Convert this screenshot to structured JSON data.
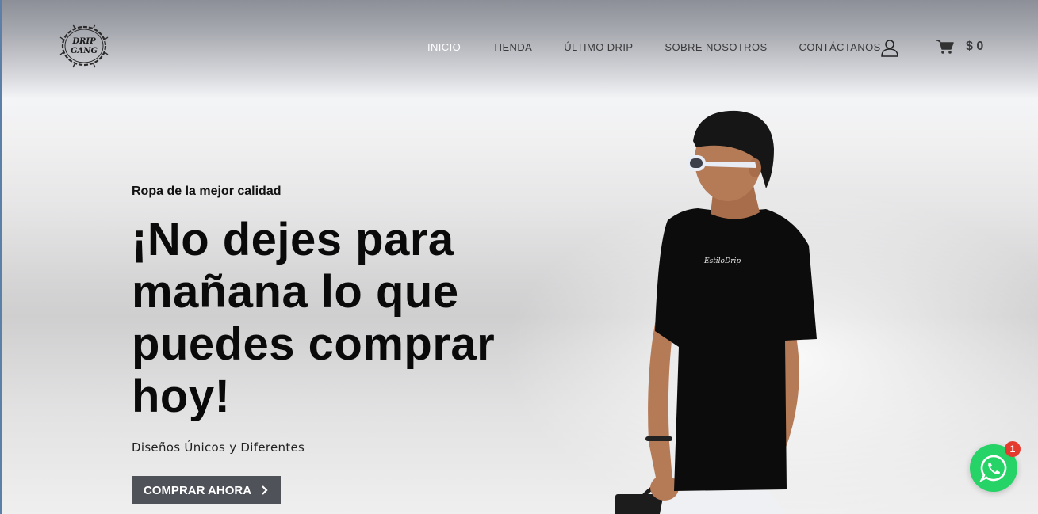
{
  "brand": {
    "logo_text_line1": "DRIP",
    "logo_text_line2": "GANG"
  },
  "nav": {
    "items": [
      {
        "label": "INICIO",
        "active": true
      },
      {
        "label": "TIENDA",
        "active": false
      },
      {
        "label": "ÚLTIMO DRIP",
        "active": false
      },
      {
        "label": "SOBRE NOSOTROS",
        "active": false
      },
      {
        "label": "CONTÁCTANOS",
        "active": false
      }
    ],
    "account_icon": "user-icon",
    "cart_icon": "cart-icon",
    "cart_total": "$ 0"
  },
  "hero": {
    "eyebrow": "Ropa de la mejor calidad",
    "headline": "¡No dejes para mañana lo que puedes comprar hoy!",
    "subtitle": "Diseños Únicos y Diferentes",
    "cta_label": "COMPRAR AHORA",
    "cta_icon": "chevron-right-icon",
    "shirt_print": "EstiloDrip"
  },
  "whatsapp": {
    "icon": "whatsapp-icon",
    "badge_count": "1"
  },
  "colors": {
    "cta_bg": "#4f5258",
    "whatsapp_green": "#25d366",
    "badge_red": "#e53b2f",
    "nav_active": "#ffffff",
    "nav_text": "#3a3a3a"
  }
}
